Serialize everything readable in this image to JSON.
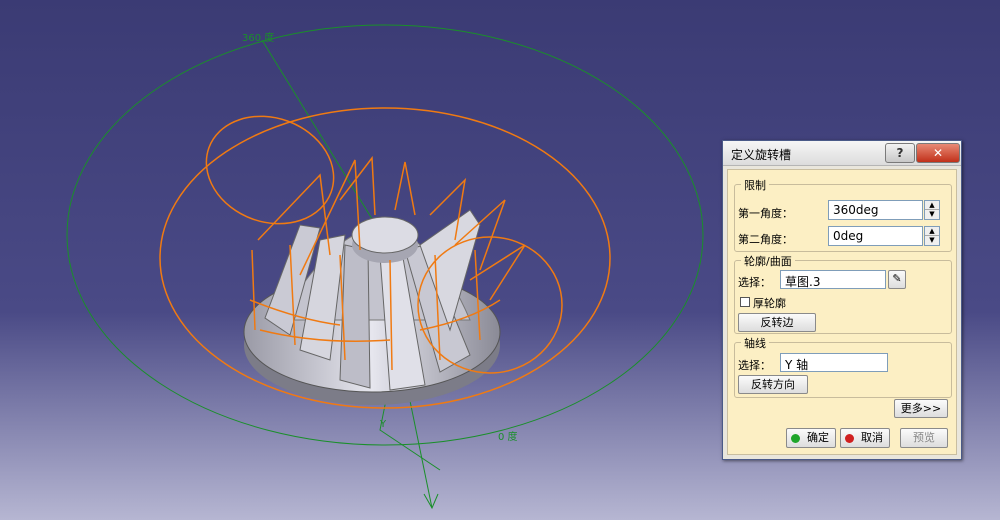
{
  "viewport": {
    "background_top": "#3b3b74",
    "background_bottom": "#b0b0cc",
    "sketch_color": "#f07a12",
    "axis_color": "#1a8f2a",
    "labels": {
      "first_angle": "360 度",
      "second_angle": "0 度",
      "axis": "Y"
    }
  },
  "dialog": {
    "title": "定义旋转槽",
    "help_label": "?",
    "close_label": "✕",
    "limits": {
      "legend": "限制",
      "first_angle_label": "第一角度：",
      "first_angle_value": "360deg",
      "second_angle_label": "第二角度：",
      "second_angle_value": "0deg"
    },
    "profile": {
      "legend": "轮廓/曲面",
      "select_label": "选择：",
      "select_value": "草图.3",
      "thick_label": "厚轮廓",
      "reverse_side_label": "反转边"
    },
    "axis": {
      "legend": "轴线",
      "select_label": "选择：",
      "select_value": "Y 轴",
      "reverse_direction_label": "反转方向"
    },
    "more_label": "更多>>",
    "ok_label": "确定",
    "cancel_label": "取消",
    "preview_label": "预览",
    "ok_color": "#1fa62a",
    "cancel_color": "#d02020"
  }
}
